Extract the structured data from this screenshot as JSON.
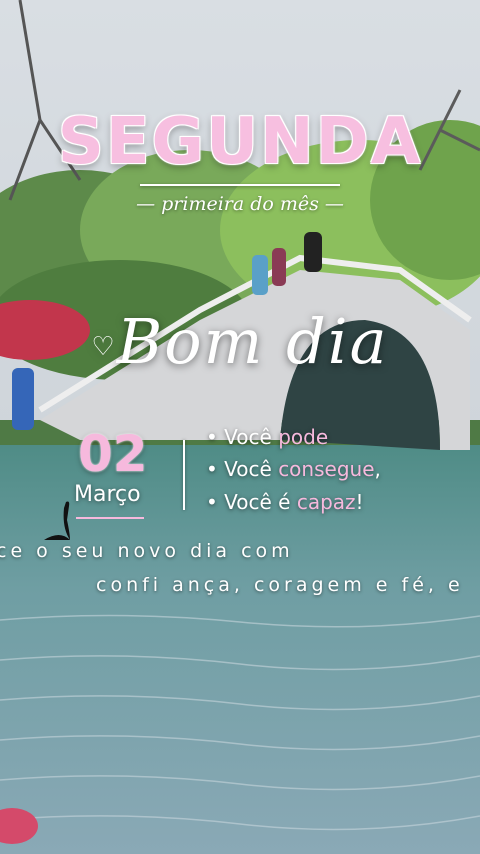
{
  "title": "SEGUNDA",
  "subtitle": "— primeira do mês —",
  "greeting": "Bom dia",
  "date": {
    "day": "02",
    "month": "Março"
  },
  "affirmations": [
    {
      "prefix": "• Você ",
      "highlight": "pode",
      "suffix": ""
    },
    {
      "prefix": "• Você ",
      "highlight": "consegue",
      "suffix": ","
    },
    {
      "prefix": "• Você é ",
      "highlight": "capaz",
      "suffix": "!"
    }
  ],
  "scrolling_text": {
    "line1": "ce o seu novo dia com",
    "line2": "confi ança, coragem e fé, e"
  },
  "colors": {
    "accent_pink": "#f6b9dd",
    "text_white": "#ffffff",
    "water": "#6f9ba0"
  }
}
